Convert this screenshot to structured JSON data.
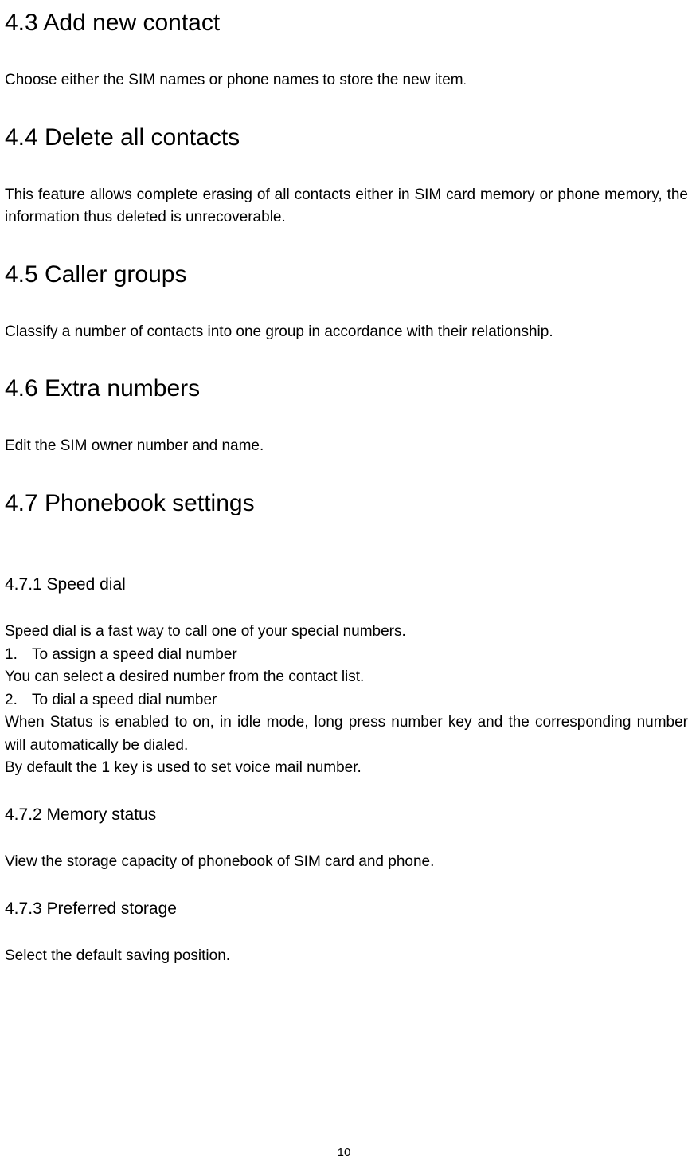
{
  "sections": {
    "s43": {
      "heading": "4.3 Add new contact",
      "body": "Choose either the SIM names or phone names to store the new item",
      "trailing_period": "."
    },
    "s44": {
      "heading": "4.4 Delete all contacts",
      "body": "This feature allows complete erasing of all contacts either in SIM card memory or phone memory, the information thus deleted is unrecoverable."
    },
    "s45": {
      "heading": "4.5 Caller groups",
      "body": "Classify a number of contacts into one group in accordance with their relationship."
    },
    "s46": {
      "heading": "4.6 Extra numbers",
      "body": "Edit the SIM owner number and name."
    },
    "s47": {
      "heading": "4.7 Phonebook settings",
      "s471": {
        "heading": "4.7.1 Speed dial",
        "intro": "Speed dial is a fast way to call one of your special numbers.",
        "item1_num": "1.",
        "item1_text": "To assign a speed dial number",
        "item1_body": "You can select a desired number from the contact list.",
        "item2_num": "2.",
        "item2_text": "To dial a speed dial number",
        "item2_body": "When Status is enabled to on, in idle mode, long press number key and the corresponding number will automatically be dialed.",
        "note": "By default the 1 key is used to set voice mail number."
      },
      "s472": {
        "heading": "4.7.2 Memory status",
        "body": "View the storage capacity of phonebook of SIM card and phone."
      },
      "s473": {
        "heading": "4.7.3 Preferred storage",
        "body": "Select the default saving position."
      }
    }
  },
  "page_number": "10"
}
